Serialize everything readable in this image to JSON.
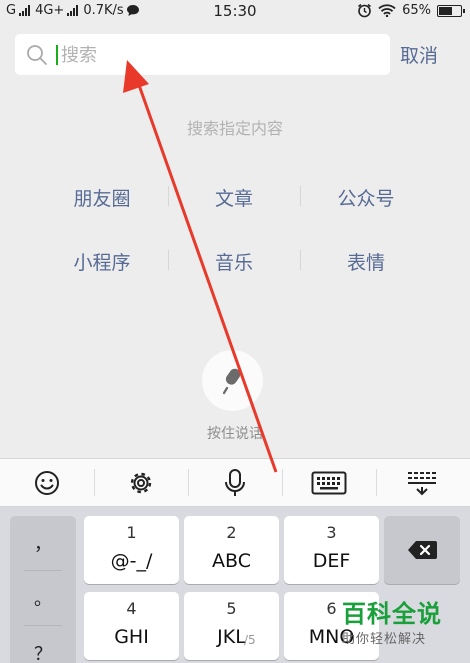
{
  "status_bar": {
    "carrier1": "G",
    "carrier2": "4G+",
    "speed": "0.7K/s",
    "time": "15:30",
    "battery": "65%",
    "battery_level": 0.65
  },
  "search": {
    "placeholder": "搜索",
    "cancel_label": "取消"
  },
  "hint": "搜索指定内容",
  "categories": [
    [
      "朋友圈",
      "文章",
      "公众号"
    ],
    [
      "小程序",
      "音乐",
      "表情"
    ]
  ],
  "voice": {
    "label": "按住说话"
  },
  "keyboard": {
    "toolbar": [
      "emoji-icon",
      "settings-icon",
      "microphone-icon",
      "keyboard-icon",
      "collapse-keyboard-icon"
    ],
    "punctuation": [
      "，",
      "。",
      "？"
    ],
    "keys": [
      {
        "num": "1",
        "letters": "@-_/"
      },
      {
        "num": "2",
        "letters": "ABC"
      },
      {
        "num": "3",
        "letters": "DEF"
      },
      {
        "num": "4",
        "letters": "GHI"
      },
      {
        "num": "5",
        "letters": "JKL"
      },
      {
        "num": "6",
        "letters": "MNO"
      }
    ],
    "delete_icon": "backspace-icon"
  },
  "watermark": {
    "title": "百科全说",
    "subtitle": "助你轻松解决"
  },
  "page_mark": "/5",
  "colors": {
    "link": "#576b95",
    "accent_green": "#1aad19",
    "annotation_red": "#e8392b"
  }
}
